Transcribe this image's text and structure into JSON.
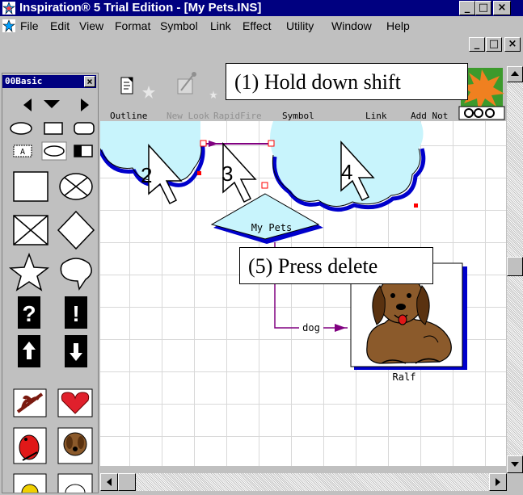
{
  "window": {
    "title": "Inspiration® 5 Trial Edition - [My Pets.INS]",
    "controls": [
      "_",
      "□",
      "×"
    ]
  },
  "menu": [
    "File",
    "Edit",
    "View",
    "Format",
    "Symbol",
    "Link",
    "Effect",
    "Utility",
    "Window",
    "Help"
  ],
  "doc_controls": [
    "_",
    "□",
    "×"
  ],
  "palette": {
    "title": "00Basic",
    "close": "×",
    "text_symbol": "A",
    "question": "?",
    "exclaim": "!"
  },
  "toolbar": {
    "buttons": [
      "Outline",
      "New Look",
      "RapidFire",
      "Symbol",
      "Link",
      "Add Not"
    ]
  },
  "canvas": {
    "steps": [
      "2",
      "3",
      "4"
    ],
    "main_idea": "My Pets",
    "link_label": "dog",
    "image_caption": "Ralf"
  },
  "callouts": {
    "step1": "(1) Hold down shift",
    "step5": "(5) Press delete"
  },
  "colors": {
    "titlebar": "#000080",
    "cloud_fill": "#c8f4fc",
    "cloud_edge": "#0000cc",
    "link": "#800080",
    "selection": "#ff0000"
  }
}
